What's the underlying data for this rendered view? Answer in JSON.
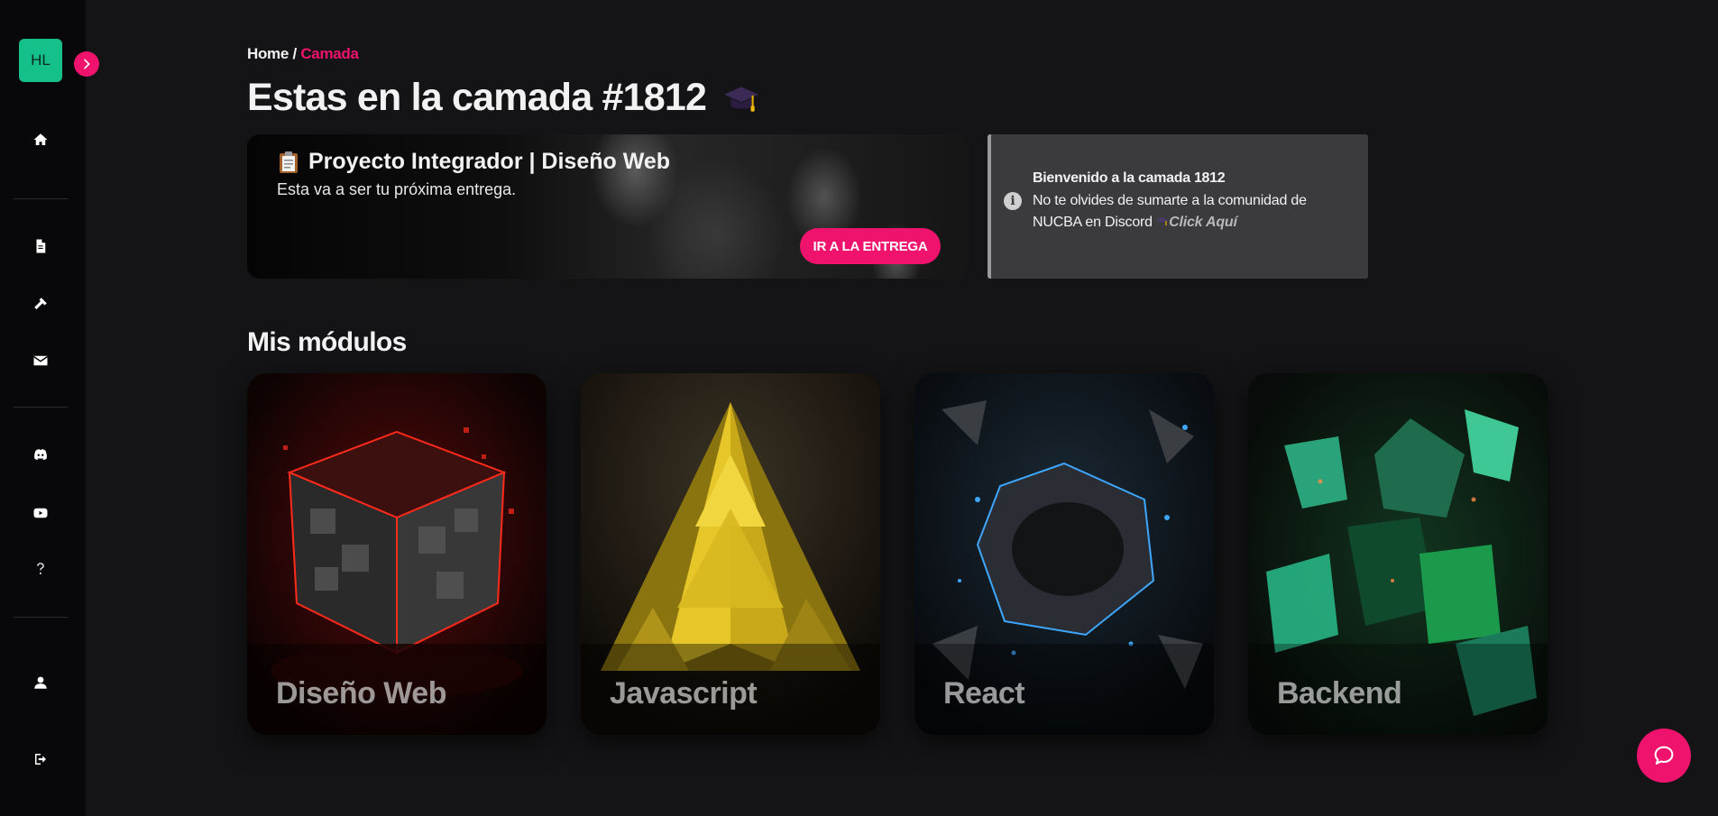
{
  "sidebar": {
    "avatar_initials": "HL",
    "items": [
      {
        "name": "home",
        "icon": "home-icon"
      },
      {
        "name": "documents",
        "icon": "file-icon"
      },
      {
        "name": "tools",
        "icon": "hammer-icon"
      },
      {
        "name": "messages",
        "icon": "envelope-icon"
      },
      {
        "name": "discord",
        "icon": "discord-icon"
      },
      {
        "name": "youtube",
        "icon": "youtube-icon"
      },
      {
        "name": "help",
        "icon": "question-icon"
      },
      {
        "name": "profile",
        "icon": "user-icon"
      },
      {
        "name": "logout",
        "icon": "logout-icon"
      }
    ]
  },
  "breadcrumb": {
    "home": "Home",
    "separator": " / ",
    "current": "Camada"
  },
  "page_title": "Estas en la camada #1812",
  "project": {
    "title": "Proyecto Integrador | Diseño Web",
    "subtitle": "Esta va a ser tu próxima entrega.",
    "button_label": "IR A LA ENTREGA"
  },
  "info": {
    "title": "Bienvenido a la camada 1812",
    "text": "No te olvides de sumarte a la comunidad de NUCBA en Discord ",
    "link": "Click Aquí"
  },
  "modules": {
    "title": "Mis módulos",
    "items": [
      {
        "label": "Diseño Web"
      },
      {
        "label": "Javascript"
      },
      {
        "label": "React"
      },
      {
        "label": "Backend"
      }
    ]
  },
  "colors": {
    "accent": "#f0136e",
    "avatar": "#16c08b",
    "background": "#141416",
    "sidebar": "#08080a"
  }
}
